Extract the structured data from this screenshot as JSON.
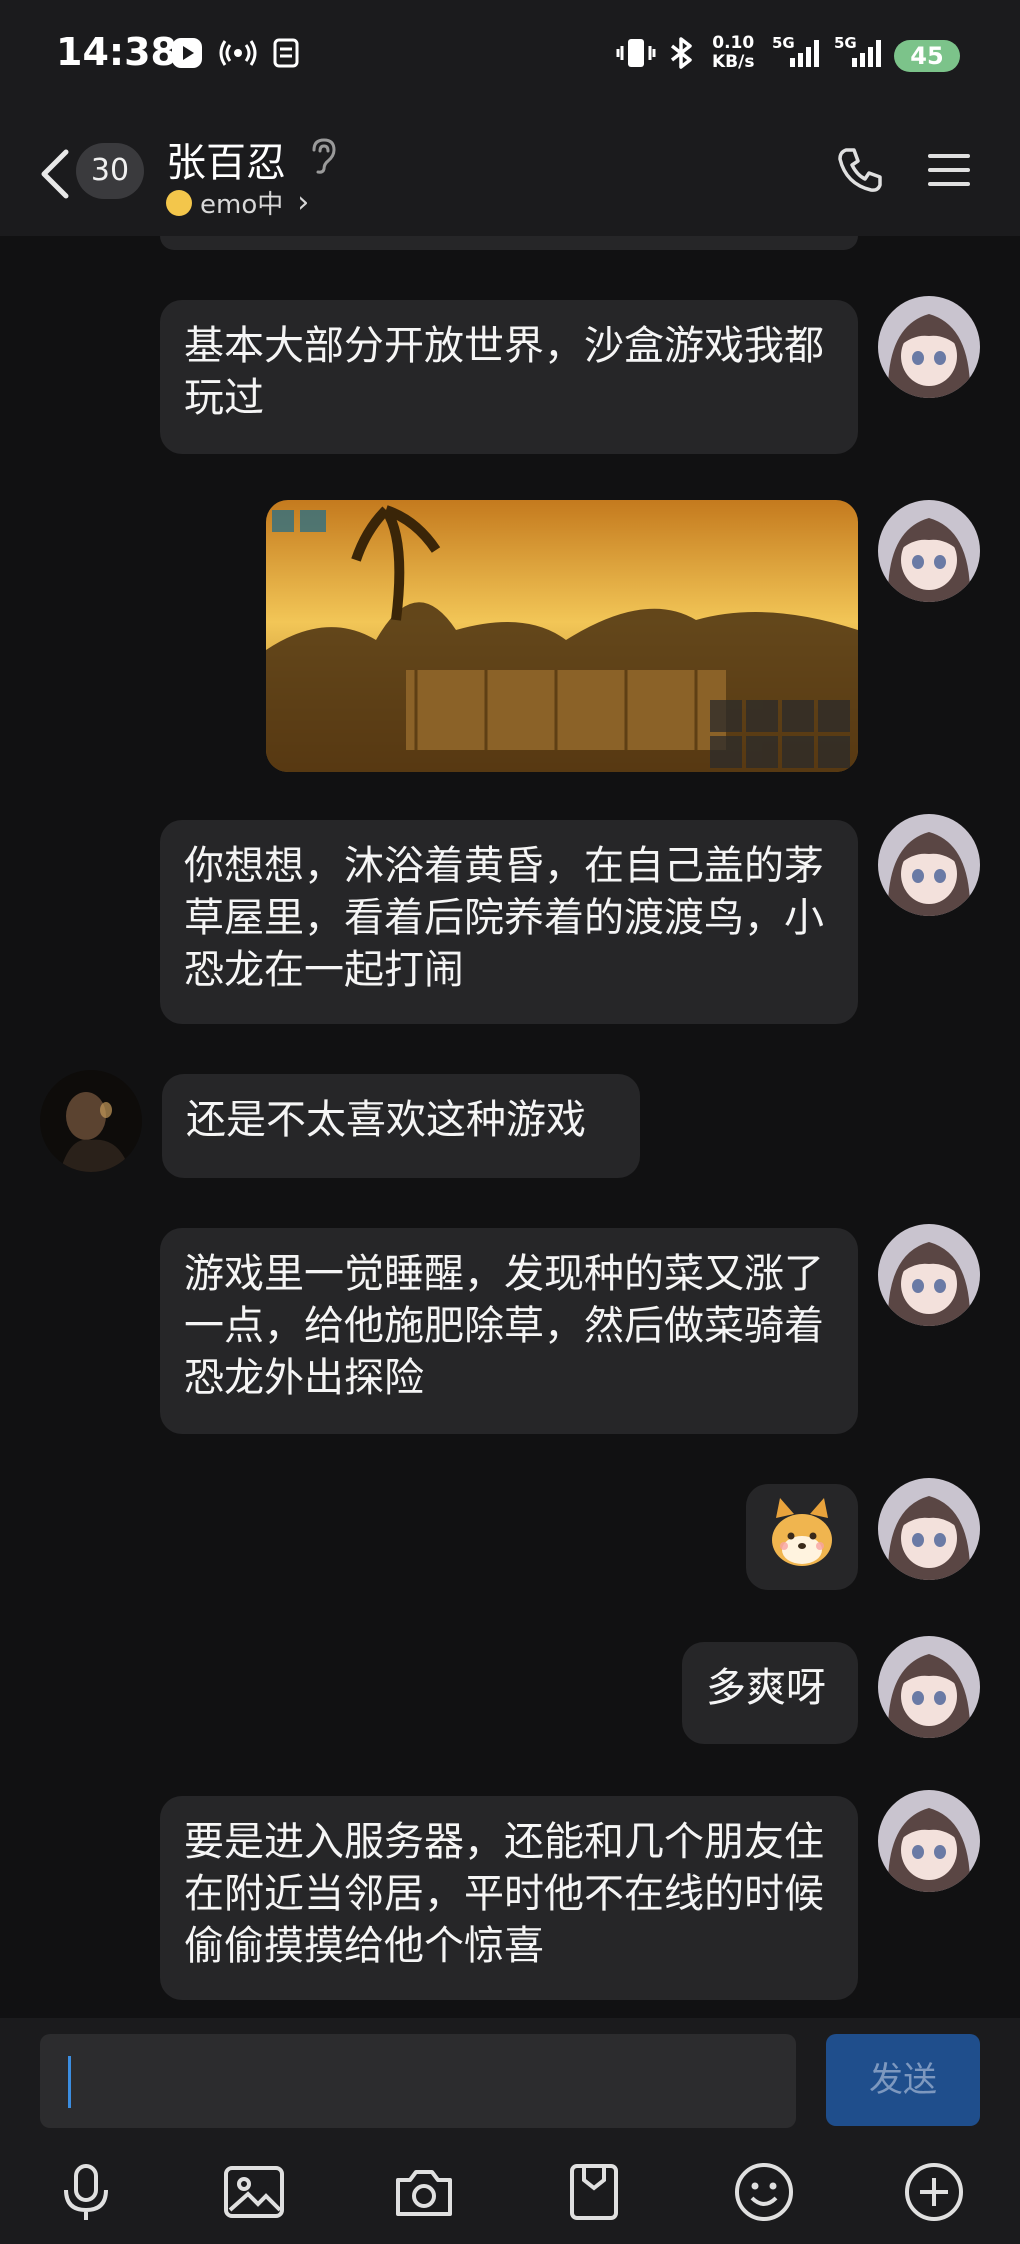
{
  "status_bar": {
    "time": "14:38",
    "net_speed_value": "0.10",
    "net_speed_unit": "KB/s",
    "sim1": "5G",
    "sim2": "5G",
    "battery": "45"
  },
  "header": {
    "unread_count": "30",
    "contact_name": "张百忍",
    "status_text": "emo中",
    "status_chevron": "›"
  },
  "messages": [
    {
      "side": "right",
      "type": "text",
      "text": "基本大部分开放世界，沙盒游戏我都玩过"
    },
    {
      "side": "right",
      "type": "image",
      "description_icon": "game-screenshot"
    },
    {
      "side": "right",
      "type": "text",
      "text": "你想想，沐浴着黄昏，在自己盖的茅草屋里，看着后院养着的渡渡鸟，小恐龙在一起打闹"
    },
    {
      "side": "left",
      "type": "text",
      "text": "还是不太喜欢这种游戏"
    },
    {
      "side": "right",
      "type": "text",
      "text": "游戏里一觉睡醒，发现种的菜又涨了一点，给他施肥除草，然后做菜骑着恐龙外出探险"
    },
    {
      "side": "right",
      "type": "sticker",
      "description_icon": "shiba-dog-sticker"
    },
    {
      "side": "right",
      "type": "text",
      "text": "多爽呀"
    },
    {
      "side": "right",
      "type": "text",
      "text": "要是进入服务器，还能和几个朋友住在附近当邻居，平时他不在线的时候偷偷摸摸给他个惊喜"
    }
  ],
  "composer": {
    "input_value": "",
    "send_label": "发送"
  },
  "toolbar_icons": [
    "microphone-icon",
    "image-icon",
    "camera-icon",
    "file-icon",
    "emoji-icon",
    "plus-icon"
  ],
  "colors": {
    "background": "#111112",
    "bubble": "#262628",
    "header": "#1b1b1d",
    "send_button": "#1f4e8c",
    "battery": "#7cc38a"
  }
}
